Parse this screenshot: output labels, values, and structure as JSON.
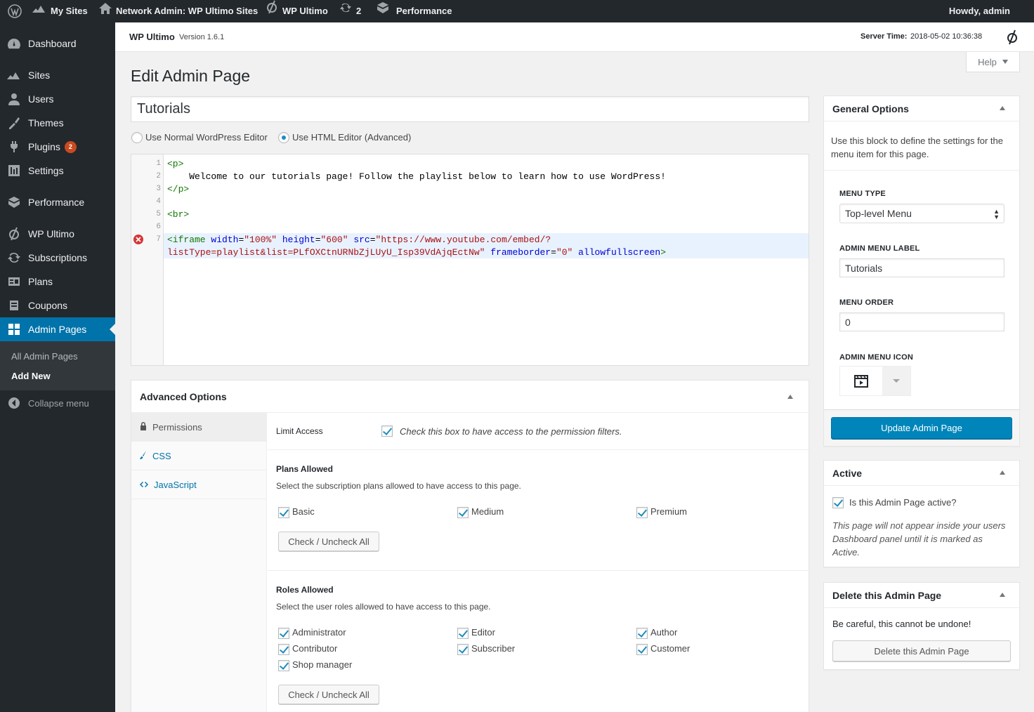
{
  "adminbar": {
    "my_sites": "My Sites",
    "network_admin": "Network Admin: WP Ultimo Sites",
    "wp_ultimo": "WP Ultimo",
    "updates_count": "2",
    "performance": "Performance",
    "howdy": "Howdy, admin"
  },
  "sidebar": {
    "items": [
      {
        "label": "Dashboard",
        "icon": "dashboard-icon"
      },
      {
        "label": "Sites",
        "icon": "sites-icon"
      },
      {
        "label": "Users",
        "icon": "users-icon"
      },
      {
        "label": "Themes",
        "icon": "themes-icon"
      },
      {
        "label": "Plugins",
        "icon": "plugins-icon",
        "badge": "2"
      },
      {
        "label": "Settings",
        "icon": "settings-icon"
      },
      {
        "label": "Performance",
        "icon": "performance-icon"
      },
      {
        "label": "WP Ultimo",
        "icon": "wp-ultimo-icon"
      },
      {
        "label": "Subscriptions",
        "icon": "subscriptions-icon"
      },
      {
        "label": "Plans",
        "icon": "plans-icon"
      },
      {
        "label": "Coupons",
        "icon": "coupons-icon"
      },
      {
        "label": "Admin Pages",
        "icon": "admin-pages-icon"
      }
    ],
    "submenu": [
      "All Admin Pages",
      "Add New"
    ],
    "collapse": "Collapse menu"
  },
  "header": {
    "brand": "WP Ultimo",
    "version": "Version 1.6.1",
    "server_time_label": "Server Time:",
    "server_time": "2018-05-02 10:36:38",
    "help": "Help"
  },
  "page": {
    "title": "Edit Admin Page",
    "post_title": "Tutorials",
    "editor_normal": "Use Normal WordPress Editor",
    "editor_html": "Use HTML Editor (Advanced)"
  },
  "code": {
    "line_numbers": [
      "1",
      "2",
      "3",
      "4",
      "5",
      "6",
      "7"
    ],
    "l1": "<p>",
    "l2": "    Welcome to our tutorials page! Follow the playlist below to learn how to use WordPress!",
    "l3": "</p>",
    "l5": "<br>",
    "l7a_tag": "<iframe",
    "l7a_a1": "width",
    "l7a_v1": "\"100%\"",
    "l7a_a2": "height",
    "l7a_v2": "\"600\"",
    "l7a_a3": "src",
    "l7a_v3": "\"https://www.youtube.com/embed/?",
    "l7b_v3": "listType=playlist&list=PLfOXCtnURNbZjLUyU_Isp39VdAjqEctNw\"",
    "l7b_a4": "frameborder",
    "l7b_v4": "\"0\"",
    "l7b_a5": "allowfullscreen",
    "l7b_end": ">"
  },
  "advanced": {
    "title": "Advanced Options",
    "tabs": [
      "Permissions",
      "CSS",
      "JavaScript"
    ],
    "limit_access_label": "Limit Access",
    "limit_access_desc": "Check this box to have access to the permission filters.",
    "plans_title": "Plans Allowed",
    "plans_desc": "Select the subscription plans allowed to have access to this page.",
    "plans": [
      "Basic",
      "Medium",
      "Premium"
    ],
    "check_all": "Check / Uncheck All",
    "roles_title": "Roles Allowed",
    "roles_desc": "Select the user roles allowed to have access to this page.",
    "roles": [
      "Administrator",
      "Editor",
      "Author",
      "Contributor",
      "Subscriber",
      "Customer",
      "Shop manager"
    ]
  },
  "general_options": {
    "title": "General Options",
    "desc": "Use this block to define the settings for the menu item for this page.",
    "menu_type_label": "Menu Type",
    "menu_type_value": "Top-level Menu",
    "menu_label_label": "Admin Menu Label",
    "menu_label_value": "Tutorials",
    "menu_order_label": "Menu Order",
    "menu_order_value": "0",
    "menu_icon_label": "Admin Menu Icon",
    "menu_icon": "video-icon",
    "update_button": "Update Admin Page"
  },
  "active_box": {
    "title": "Active",
    "checkbox_label": "Is this Admin Page active?",
    "note": "This page will not appear inside your users Dashboard panel until it is marked as Active."
  },
  "delete_box": {
    "title": "Delete this Admin Page",
    "warning": "Be careful, this cannot be undone!",
    "button": "Delete this Admin Page"
  },
  "colors": {
    "adminbar": "#23282d",
    "accent": "#0073aa",
    "primary_button": "#0085ba",
    "badge": "#ca4a1f",
    "error": "#d63638"
  }
}
